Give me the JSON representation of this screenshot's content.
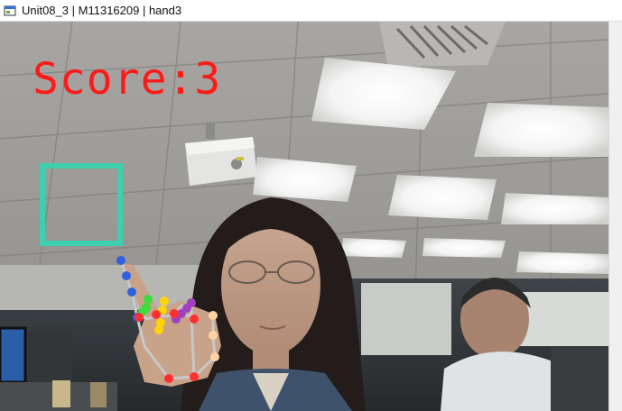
{
  "window": {
    "title": "Unit08_3 | M11316209 | hand3",
    "icon": "app-window-icon"
  },
  "overlay": {
    "score_text": "Score:3",
    "score_color": "#ff1a1a",
    "target_box_color": "#3ecfae"
  },
  "scene": {
    "description_icon": "webcam-frame",
    "hand_landmarks_colors": {
      "thumb": "#ffd3a6",
      "index": "#3060e0",
      "middle": "#ffd400",
      "ring": "#3cdc3c",
      "pinky": "#a040c0",
      "palm": "#ff3030",
      "connections": "#c8c8c8"
    }
  }
}
